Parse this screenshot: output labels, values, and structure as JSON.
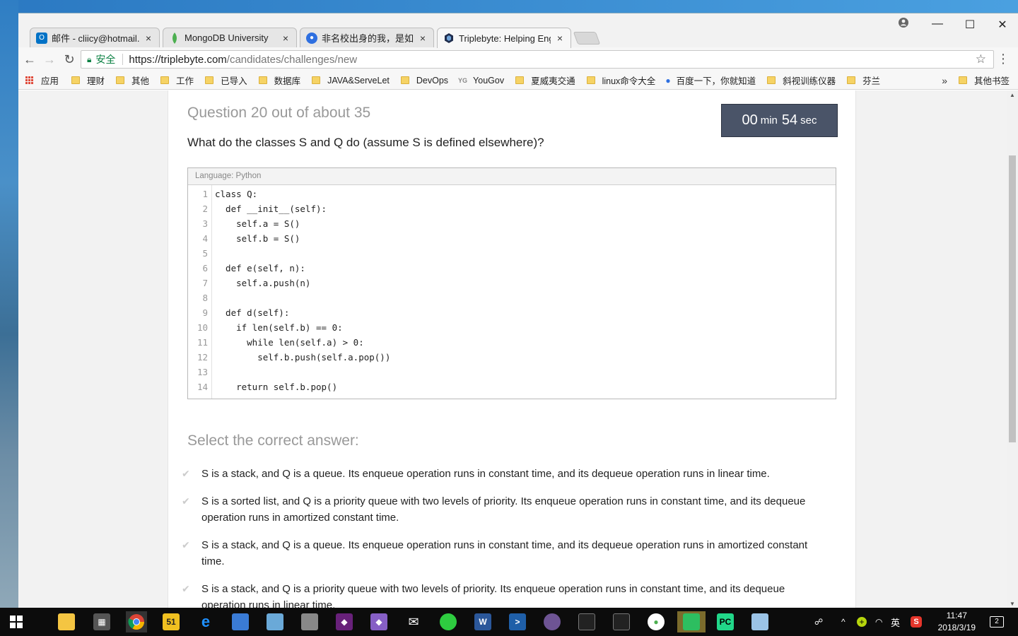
{
  "browser": {
    "tabs": [
      {
        "label": "邮件 - cliicy@hotmail.c",
        "icon": "outlook-icon",
        "color": "#0072c6"
      },
      {
        "label": "MongoDB University",
        "icon": "mongodb-leaf-icon",
        "color": "#4caf50"
      },
      {
        "label": "非名校出身的我，是如何",
        "icon": "baidu-paw-icon",
        "color": "#2e6fe0"
      },
      {
        "label": "Triplebyte: Helping Eng",
        "icon": "triplebyte-hex-icon",
        "color": "#1f2d4d"
      }
    ],
    "close_glyph": "×",
    "secure_label": "安全",
    "url_host": "https://triplebyte.com",
    "url_path": "/candidates/challenges/new"
  },
  "bookmarks": {
    "items": [
      "应用",
      "理财",
      "其他",
      "工作",
      "已导入",
      "数据库",
      "JAVA&ServeLet",
      "DevOps",
      "YouGov",
      "夏威夷交通",
      "linux命令大全",
      "百度一下，你就知道",
      "斜视训练仪器",
      "芬兰"
    ],
    "more": "»",
    "other": "其他书签"
  },
  "quiz": {
    "question_header": "Question 20 out of about 35",
    "timer": {
      "minutes": "00",
      "min_label": "min",
      "seconds": "54",
      "sec_label": "sec"
    },
    "question_text": "What do the classes S and Q do (assume S is defined elsewhere)?",
    "code_language": "Language: Python",
    "code_lines": [
      "class Q:",
      "  def __init__(self):",
      "    self.a = S()",
      "    self.b = S()",
      "",
      "  def e(self, n):",
      "    self.a.push(n)",
      "",
      "  def d(self):",
      "    if len(self.b) == 0:",
      "      while len(self.a) > 0:",
      "        self.b.push(self.a.pop())",
      "",
      "    return self.b.pop()"
    ],
    "select_header": "Select the correct answer:",
    "answers": [
      "S is a stack, and Q is a queue. Its enqueue operation runs in constant time, and its dequeue operation runs in linear time.",
      "S is a sorted list, and Q is a priority queue with two levels of priority. Its enqueue operation runs in constant time, and its dequeue operation runs in amortized constant time.",
      "S is a stack, and Q is a queue. Its enqueue operation runs in constant time, and its dequeue operation runs in amortized constant time.",
      "S is a stack, and Q is a priority queue with two levels of priority. Its enqueue operation runs in constant time, and its dequeue operation runs in linear time."
    ]
  },
  "taskbar": {
    "ime": "英",
    "time": "11:47",
    "date": "2018/3/19",
    "notification_count": "2"
  }
}
